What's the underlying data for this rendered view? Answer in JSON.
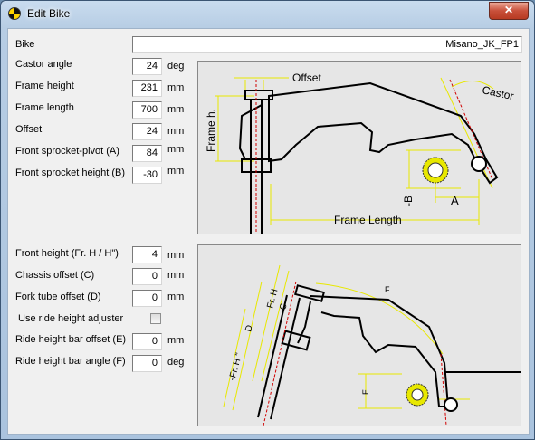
{
  "window": {
    "title": "Edit Bike",
    "close_label": "✕"
  },
  "bike": {
    "label": "Bike",
    "value": "Misano_JK_FP1"
  },
  "fields_top": [
    {
      "label": "Castor angle",
      "value": "24",
      "unit": "deg"
    },
    {
      "label": "Frame height",
      "value": "231",
      "unit": "mm"
    },
    {
      "label": "Frame length",
      "value": "700",
      "unit": "mm"
    },
    {
      "label": "Offset",
      "value": "24",
      "unit": "mm"
    },
    {
      "label": "Front sprocket-pivot (A)",
      "value": "84",
      "unit": "mm"
    },
    {
      "label": "Front sprocket height (B)",
      "value": "-30",
      "unit": "mm"
    }
  ],
  "fields_bottom": [
    {
      "label": "Front height (Fr. H / H\")",
      "value": "4",
      "unit": "mm"
    },
    {
      "label": "Chassis offset (C)",
      "value": "0",
      "unit": "mm"
    },
    {
      "label": "Fork tube offset (D)",
      "value": "0",
      "unit": "mm"
    }
  ],
  "ride_height_adjuster": {
    "label": "Use ride height adjuster",
    "checked": false
  },
  "fields_bottom2": [
    {
      "label": "Ride height bar offset (E)",
      "value": "0",
      "unit": "mm"
    },
    {
      "label": "Ride height bar angle (F)",
      "value": "0",
      "unit": "deg"
    }
  ],
  "diagram_top": {
    "offset": "Offset",
    "castor": "Castor",
    "frame_h": "Frame h.",
    "frame_length": "Frame Length",
    "b": "-B",
    "a": "A"
  },
  "diagram_bottom": {
    "fr_h": "Fr. H",
    "c": "C",
    "d": "D",
    "fr_h2": "-Fr. H \"",
    "f": "F",
    "e": "E"
  },
  "colors": {
    "yellow": "#e8e800",
    "red": "#d00000"
  }
}
